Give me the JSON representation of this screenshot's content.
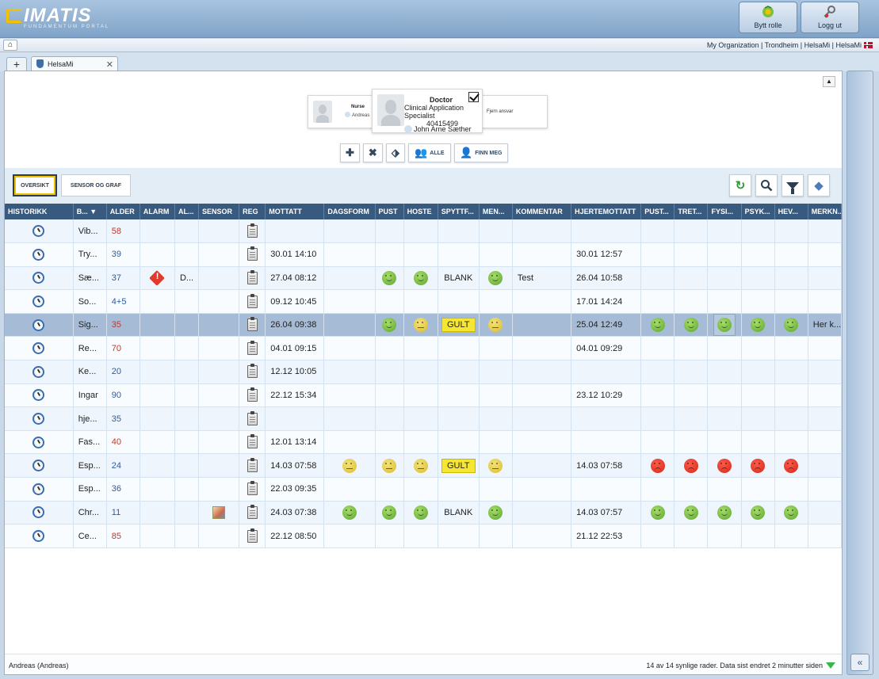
{
  "header": {
    "logo_text": "IMATIS",
    "logo_subtitle": "FUNDAMENTUM PORTAL",
    "switch_role_label": "Bytt rolle",
    "logout_label": "Logg ut"
  },
  "subbar": {
    "org_path": "My Organization | Trondheim | HelsaMi | HelsaMi"
  },
  "tabs": [
    {
      "label": "HelsaMi"
    }
  ],
  "staff": {
    "left": {
      "role": "Nurse",
      "name": "Andreas"
    },
    "main": {
      "role": "Doctor",
      "title": "Clinical Application Specialist",
      "number": "40415499",
      "name": "John Arne Sæther"
    },
    "right": {
      "label": "Fjern ansvar"
    }
  },
  "actions": {
    "all_label": "ALLE",
    "find_me_label": "FINN MEG"
  },
  "view_tabs": {
    "overview": "OVERSIKT",
    "sensor_graph": "SENSOR OG GRAF"
  },
  "columns": [
    "HISTORIKK",
    "B... ▼",
    "ALDER",
    "ALARM",
    "AL...",
    "SENSOR",
    "REG",
    "MOTTATT",
    "DAGSFORM",
    "PUST",
    "HOSTE",
    "SPYTTF...",
    "MEN...",
    "KOMMENTAR",
    "HJERTEMOTTATT",
    "PUST...",
    "TRET...",
    "FYSI...",
    "PSYK...",
    "HEV...",
    "MERKN..."
  ],
  "rows": [
    {
      "name": "Vib...",
      "age": "58",
      "age_color": "red",
      "alarm": false,
      "alarm_text": "",
      "sensor": false,
      "received": "",
      "dagsform": "",
      "pust": "",
      "hoste": "",
      "spytt": "",
      "spytt_tag": "",
      "men": "",
      "comment": "",
      "heart": "",
      "pust2": "",
      "tret": "",
      "fysi": "",
      "psyk": "",
      "hev": "",
      "merkn": ""
    },
    {
      "name": "Try...",
      "age": "39",
      "age_color": "blue",
      "alarm": false,
      "alarm_text": "",
      "sensor": false,
      "received": "30.01 14:10",
      "dagsform": "",
      "pust": "",
      "hoste": "",
      "spytt": "",
      "spytt_tag": "",
      "men": "",
      "comment": "",
      "heart": "30.01 12:57",
      "pust2": "",
      "tret": "",
      "fysi": "",
      "psyk": "",
      "hev": "",
      "merkn": ""
    },
    {
      "name": "Sæ...",
      "age": "37",
      "age_color": "blue",
      "alarm": true,
      "alarm_text": "D...",
      "sensor": false,
      "received": "27.04 08:12",
      "dagsform": "",
      "pust": "green",
      "hoste": "green",
      "spytt": "BLANK",
      "spytt_tag": "",
      "men": "green",
      "comment": "Test",
      "heart": "26.04 10:58",
      "pust2": "",
      "tret": "",
      "fysi": "",
      "psyk": "",
      "hev": "",
      "merkn": ""
    },
    {
      "name": "So...",
      "age": "4+5",
      "age_color": "blue",
      "alarm": false,
      "alarm_text": "",
      "sensor": false,
      "received": "09.12 10:45",
      "dagsform": "",
      "pust": "",
      "hoste": "",
      "spytt": "",
      "spytt_tag": "",
      "men": "",
      "comment": "",
      "heart": "17.01 14:24",
      "pust2": "",
      "tret": "",
      "fysi": "",
      "psyk": "",
      "hev": "",
      "merkn": ""
    },
    {
      "name": "Sig...",
      "age": "35",
      "age_color": "red",
      "alarm": false,
      "alarm_text": "",
      "sensor": false,
      "received": "26.04 09:38",
      "dagsform": "",
      "pust": "green",
      "hoste": "yellow",
      "spytt": "GULT",
      "spytt_tag": "gult",
      "men": "yellow",
      "comment": "",
      "heart": "25.04 12:49",
      "pust2": "green",
      "tret": "green",
      "fysi": "green-box",
      "psyk": "green",
      "hev": "green",
      "merkn": "Her k...",
      "selected": true
    },
    {
      "name": "Re...",
      "age": "70",
      "age_color": "red",
      "alarm": false,
      "alarm_text": "",
      "sensor": false,
      "received": "04.01 09:15",
      "dagsform": "",
      "pust": "",
      "hoste": "",
      "spytt": "",
      "spytt_tag": "",
      "men": "",
      "comment": "",
      "heart": "04.01 09:29",
      "pust2": "",
      "tret": "",
      "fysi": "",
      "psyk": "",
      "hev": "",
      "merkn": ""
    },
    {
      "name": "Ke...",
      "age": "20",
      "age_color": "blue",
      "alarm": false,
      "alarm_text": "",
      "sensor": false,
      "received": "12.12 10:05",
      "dagsform": "",
      "pust": "",
      "hoste": "",
      "spytt": "",
      "spytt_tag": "",
      "men": "",
      "comment": "",
      "heart": "",
      "pust2": "",
      "tret": "",
      "fysi": "",
      "psyk": "",
      "hev": "",
      "merkn": ""
    },
    {
      "name": "Ingar",
      "age": "90",
      "age_color": "blue",
      "alarm": false,
      "alarm_text": "",
      "sensor": false,
      "received": "22.12 15:34",
      "dagsform": "",
      "pust": "",
      "hoste": "",
      "spytt": "",
      "spytt_tag": "",
      "men": "",
      "comment": "",
      "heart": "23.12 10:29",
      "pust2": "",
      "tret": "",
      "fysi": "",
      "psyk": "",
      "hev": "",
      "merkn": ""
    },
    {
      "name": "hje...",
      "age": "35",
      "age_color": "blue",
      "alarm": false,
      "alarm_text": "",
      "sensor": false,
      "received": "",
      "dagsform": "",
      "pust": "",
      "hoste": "",
      "spytt": "",
      "spytt_tag": "",
      "men": "",
      "comment": "",
      "heart": "",
      "pust2": "",
      "tret": "",
      "fysi": "",
      "psyk": "",
      "hev": "",
      "merkn": ""
    },
    {
      "name": "Fas...",
      "age": "40",
      "age_color": "red",
      "alarm": false,
      "alarm_text": "",
      "sensor": false,
      "received": "12.01 13:14",
      "dagsform": "",
      "pust": "",
      "hoste": "",
      "spytt": "",
      "spytt_tag": "",
      "men": "",
      "comment": "",
      "heart": "",
      "pust2": "",
      "tret": "",
      "fysi": "",
      "psyk": "",
      "hev": "",
      "merkn": ""
    },
    {
      "name": "Esp...",
      "age": "24",
      "age_color": "blue",
      "alarm": false,
      "alarm_text": "",
      "sensor": false,
      "received": "14.03 07:58",
      "dagsform": "yellow",
      "pust": "yellow",
      "hoste": "yellow",
      "spytt": "GULT",
      "spytt_tag": "gult",
      "men": "yellow",
      "comment": "",
      "heart": "14.03 07:58",
      "pust2": "red",
      "tret": "red",
      "fysi": "red",
      "psyk": "red",
      "hev": "red",
      "merkn": ""
    },
    {
      "name": "Esp...",
      "age": "36",
      "age_color": "blue",
      "alarm": false,
      "alarm_text": "",
      "sensor": false,
      "received": "22.03 09:35",
      "dagsform": "",
      "pust": "",
      "hoste": "",
      "spytt": "",
      "spytt_tag": "",
      "men": "",
      "comment": "",
      "heart": "",
      "pust2": "",
      "tret": "",
      "fysi": "",
      "psyk": "",
      "hev": "",
      "merkn": ""
    },
    {
      "name": "Chr...",
      "age": "11",
      "age_color": "blue",
      "alarm": false,
      "alarm_text": "",
      "sensor": true,
      "received": "24.03 07:38",
      "dagsform": "green",
      "pust": "green",
      "hoste": "green",
      "spytt": "BLANK",
      "spytt_tag": "",
      "men": "green",
      "comment": "",
      "heart": "14.03 07:57",
      "pust2": "green",
      "tret": "green",
      "fysi": "green",
      "psyk": "green",
      "hev": "green",
      "merkn": ""
    },
    {
      "name": "Ce...",
      "age": "85",
      "age_color": "red",
      "alarm": false,
      "alarm_text": "",
      "sensor": false,
      "received": "22.12 08:50",
      "dagsform": "",
      "pust": "",
      "hoste": "",
      "spytt": "",
      "spytt_tag": "",
      "men": "",
      "comment": "",
      "heart": "21.12 22:53",
      "pust2": "",
      "tret": "",
      "fysi": "",
      "psyk": "",
      "hev": "",
      "merkn": ""
    }
  ],
  "status": {
    "user": "Andreas (Andreas)",
    "info": "14 av 14 synlige rader. Data sist endret 2 minutter siden"
  },
  "colors": {
    "header_bg": "#395a7f",
    "selected_row": "#a6bcd6",
    "age_red": "#c0392b",
    "age_blue": "#2a5da8",
    "gult_tag": "#f5e634"
  }
}
